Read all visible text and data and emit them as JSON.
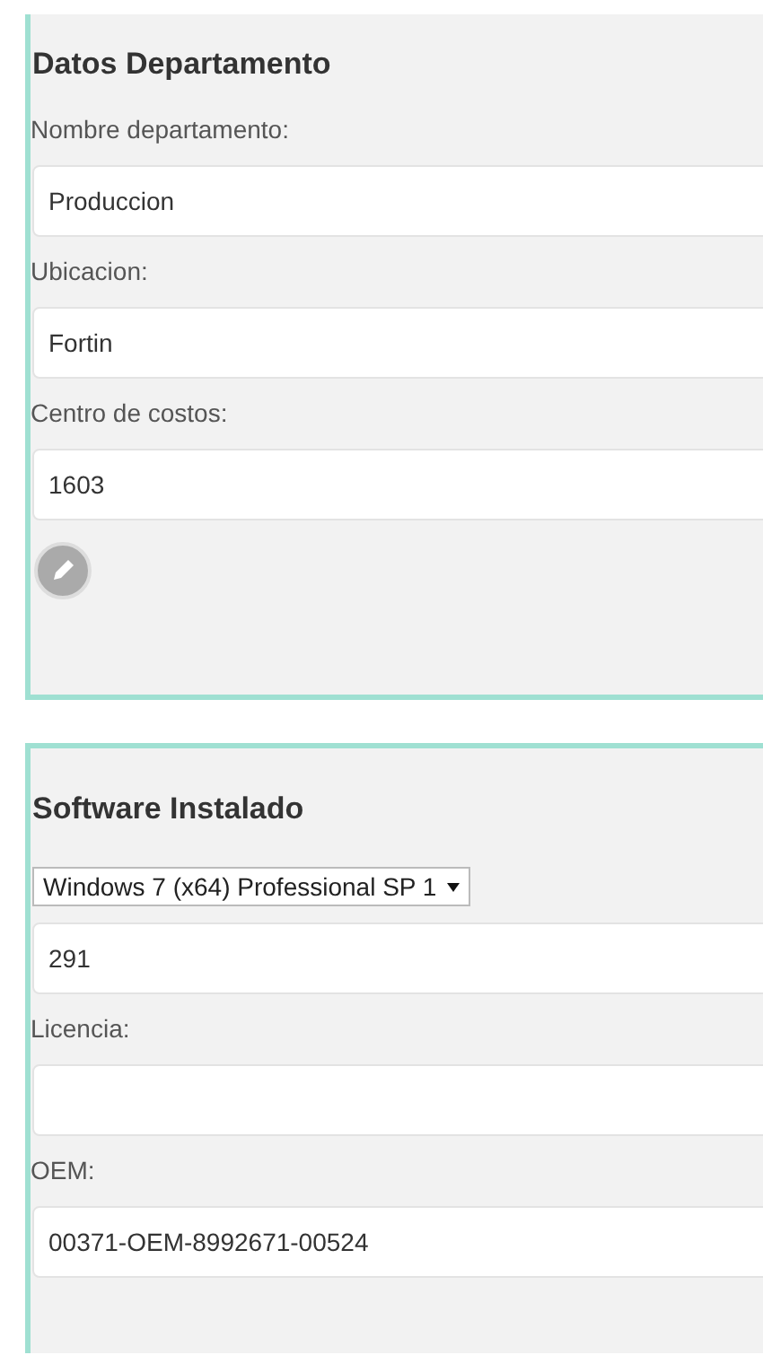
{
  "sections": [
    {
      "title": "Datos Departamento",
      "items": [
        {
          "kind": "label",
          "text": "Nombre departamento:"
        },
        {
          "kind": "input",
          "value": "Produccion"
        },
        {
          "kind": "label",
          "text": "Ubicacion:"
        },
        {
          "kind": "input",
          "value": "Fortin"
        },
        {
          "kind": "label",
          "text": "Centro de costos:"
        },
        {
          "kind": "input",
          "value": "1603"
        },
        {
          "kind": "edit"
        }
      ]
    },
    {
      "title": "Software Instalado",
      "items": [
        {
          "kind": "select",
          "value": "Windows 7 (x64) Professional SP 1"
        },
        {
          "kind": "input",
          "value": "291"
        },
        {
          "kind": "label",
          "text": "Licencia:"
        },
        {
          "kind": "input",
          "value": ""
        },
        {
          "kind": "label",
          "text": "OEM:"
        },
        {
          "kind": "input",
          "value": "00371-OEM-8992671-00524"
        }
      ]
    }
  ]
}
